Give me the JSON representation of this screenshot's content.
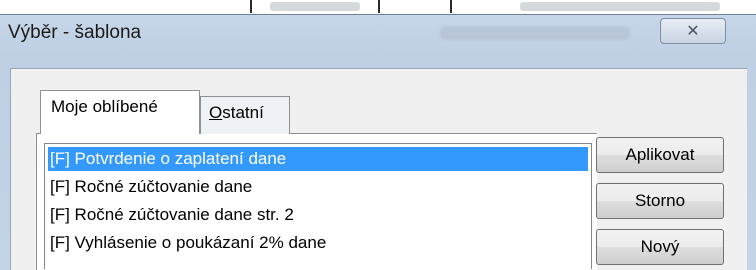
{
  "window": {
    "title": "Výběr - šablona",
    "close_glyph": "✕"
  },
  "tabs": [
    {
      "label": "Moje oblíbené",
      "active": true
    },
    {
      "label_prefix": "",
      "label_underline": "O",
      "label_rest": "statní",
      "active": false
    }
  ],
  "list": {
    "items": [
      {
        "label": "[F] Potvrdenie o zaplatení dane",
        "selected": true
      },
      {
        "label": "[F] Ročné zúčtovanie dane",
        "selected": false
      },
      {
        "label": "[F] Ročné zúčtovanie dane str. 2",
        "selected": false
      },
      {
        "label": "[F] Vyhlásenie o poukázaní 2% dane",
        "selected": false
      }
    ]
  },
  "buttons": {
    "apply": "Aplikovat",
    "cancel": "Storno",
    "new": "Nový"
  },
  "colors": {
    "selection": "#3399ff",
    "title_bar": "#c7d6e8"
  }
}
